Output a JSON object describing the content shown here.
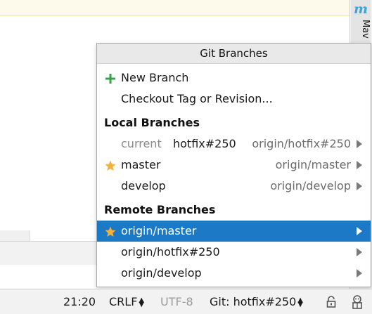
{
  "popup": {
    "title": "Git Branches",
    "new_branch": "New Branch",
    "checkout_tag": "Checkout Tag or Revision...",
    "local_header": "Local Branches",
    "remote_header": "Remote Branches",
    "local_branches": [
      {
        "prefix": "current",
        "name": "hotfix#250",
        "tracking": "origin/hotfix#250",
        "favorite": false
      },
      {
        "name": "master",
        "tracking": "origin/master",
        "favorite": true
      },
      {
        "name": "develop",
        "tracking": "origin/develop",
        "favorite": false
      }
    ],
    "remote_branches": [
      {
        "name": "origin/master",
        "favorite": true,
        "selected": true
      },
      {
        "name": "origin/hotfix#250",
        "favorite": false,
        "selected": false
      },
      {
        "name": "origin/develop",
        "favorite": false,
        "selected": false
      }
    ]
  },
  "statusbar": {
    "position": "21:20",
    "line_separator": "CRLF",
    "encoding": "UTF-8",
    "vcs_branch": "Git: hotfix#250"
  },
  "side_tool": {
    "icon_glyph": "m",
    "label": "Mav"
  },
  "colors": {
    "selection": "#1b79c6",
    "plus_green": "#3aa14b",
    "star_gold": "#f4b13a",
    "maven_blue": "#3ea3d9"
  },
  "icons": {
    "new_branch": "plus-icon",
    "favorite": "star-icon",
    "submenu": "triangle-right-icon",
    "lock": "lock-icon",
    "inspector": "inspector-icon"
  }
}
